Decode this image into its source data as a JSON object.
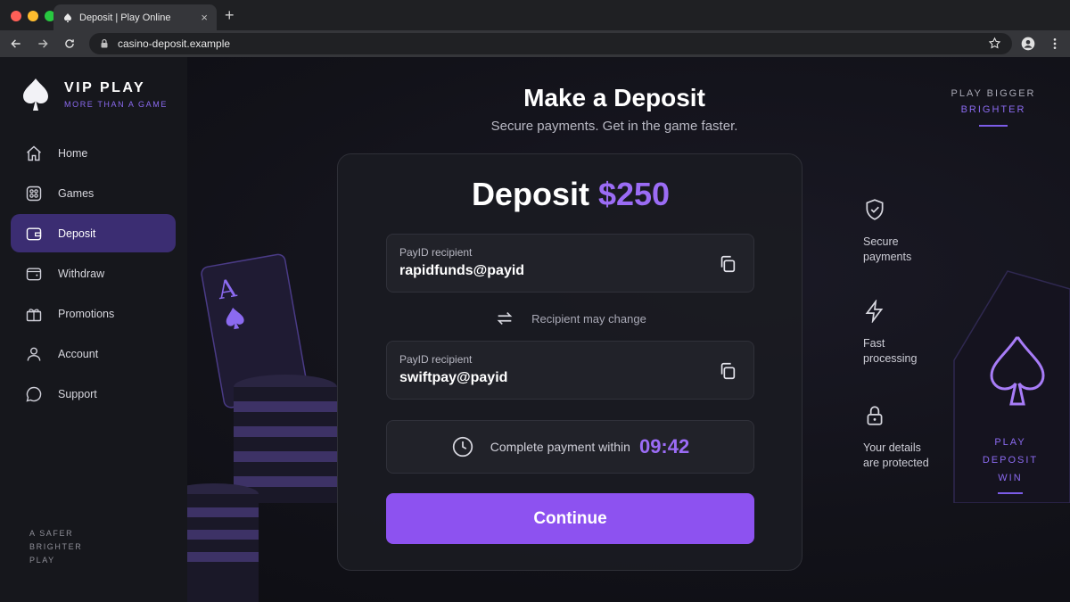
{
  "browser": {
    "tab_title": "Deposit | Play Online",
    "tab_close": "×",
    "new_tab": "+",
    "url": "casino-deposit.example"
  },
  "sidebar": {
    "brand_name": "VIP PLAY",
    "brand_tagline": "MORE THAN A GAME",
    "items": [
      {
        "label": "Home",
        "icon": "home-icon"
      },
      {
        "label": "Games",
        "icon": "games-icon"
      },
      {
        "label": "Deposit",
        "icon": "wallet-icon",
        "active": true
      },
      {
        "label": "Withdraw",
        "icon": "withdraw-icon"
      },
      {
        "label": "Promotions",
        "icon": "gift-icon"
      },
      {
        "label": "Account",
        "icon": "user-icon"
      },
      {
        "label": "Support",
        "icon": "chat-icon"
      }
    ],
    "footer": [
      "A SAFER",
      "BRIGHTER",
      "PLAY"
    ]
  },
  "header": {
    "title": "Make a Deposit",
    "subtitle": "Secure payments. Get in the game faster.",
    "top_right_line1": "PLAY BIGGER",
    "top_right_line2": "BRIGHTER"
  },
  "deposit": {
    "label": "Deposit",
    "amount": "$250",
    "recipients": [
      {
        "label": "PayID recipient",
        "value": "rapidfunds@payid"
      },
      {
        "label": "PayID recipient",
        "value": "swiftpay@payid"
      }
    ],
    "change_note": "Recipient may change",
    "timer_label": "Complete payment within",
    "timer_value": "09:42",
    "continue_label": "Continue"
  },
  "features": [
    {
      "icon": "shield-check-icon",
      "line1": "Secure",
      "line2": "payments"
    },
    {
      "icon": "lightning-icon",
      "line1": "Fast",
      "line2": "processing"
    },
    {
      "icon": "lock-icon",
      "line1": "Your details",
      "line2": "are protected"
    }
  ],
  "right_words": [
    "PLAY",
    "DEPOSIT",
    "WIN"
  ],
  "colors": {
    "accent": "#8d52f0",
    "accent_text": "#9b6cf5",
    "sidebar_active": "#3b2d72",
    "background": "#121219"
  }
}
